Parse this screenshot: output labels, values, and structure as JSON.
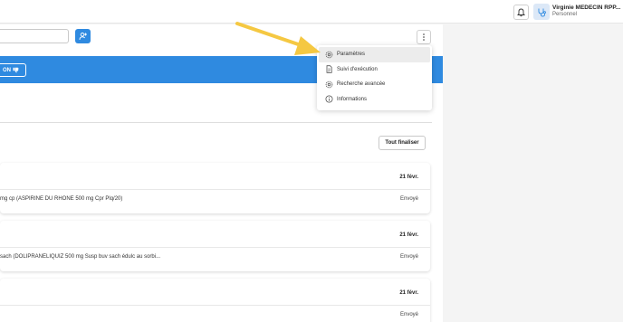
{
  "header": {
    "user_name": "Virginie MEDECIN RPP...",
    "user_role": "Personnel",
    "notification_icon": "bell-icon",
    "avatar_icon": "stethoscope-icon"
  },
  "toolbar": {
    "search_value": "",
    "add_icon": "add-patient-icon",
    "more_icon": "vertical-dots-icon"
  },
  "banner": {
    "button_label": "ON",
    "button_icon": "thumbs-down-icon",
    "color": "#2f8ae0"
  },
  "actions": {
    "finalize_all_label": "Tout finaliser"
  },
  "prescriptions": [
    {
      "date": "21 févr.",
      "description": "mg cp (ASPIRINE DU RHONE 500 mg Cpr Plq/20)",
      "status": "Envoyé"
    },
    {
      "date": "21 févr.",
      "description": "sach (DOLIPRANELIQUIZ 500 mg Susp buv sach édulc au sorbi...",
      "status": "Envoyé"
    },
    {
      "date": "21 févr.",
      "description": "",
      "status": "Envoyé"
    }
  ],
  "dropdown_menu": {
    "items": [
      {
        "label": "Paramètres",
        "icon": "gear-icon",
        "active": true
      },
      {
        "label": "Suivi d'exécution",
        "icon": "document-icon",
        "active": false
      },
      {
        "label": "Recherche avancée",
        "icon": "gear-icon",
        "active": false
      },
      {
        "label": "Informations",
        "icon": "info-icon",
        "active": false
      }
    ]
  },
  "annotation": {
    "arrow_color": "#f5c842"
  },
  "colors": {
    "accent": "#2f8ae0",
    "background": "#f4f4f4"
  }
}
